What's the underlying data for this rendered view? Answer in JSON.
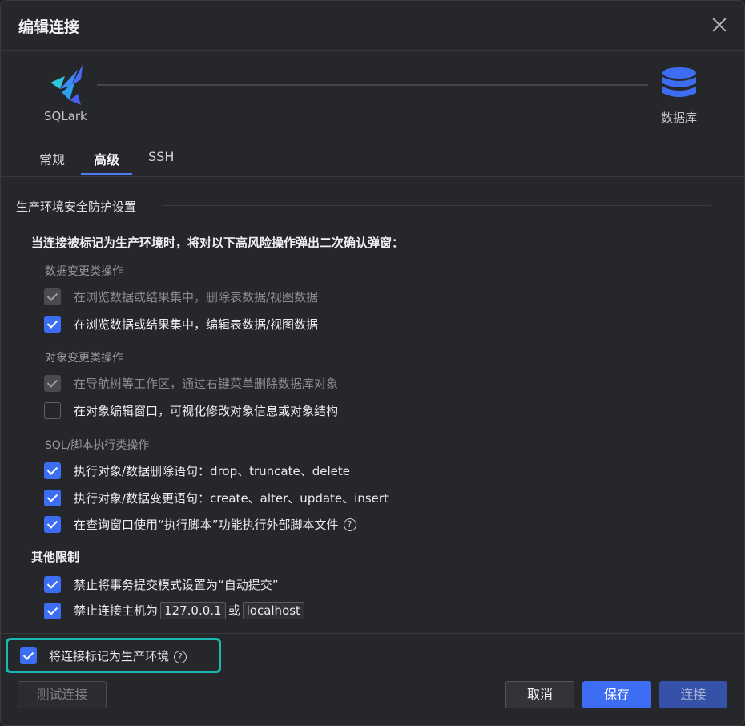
{
  "dialog": {
    "title": "编辑连接"
  },
  "header": {
    "source_label": "SQLark",
    "target_label": "数据库"
  },
  "tabs": [
    {
      "label": "常规",
      "active": false
    },
    {
      "label": "高级",
      "active": true
    },
    {
      "label": "SSH",
      "active": false
    }
  ],
  "section": {
    "title": "生产环境安全防护设置",
    "lead": "当连接被标记为生产环境时，将对以下高风险操作弹出二次确认弹窗：",
    "groups": [
      {
        "title": "数据变更类操作",
        "items": [
          {
            "label": "在浏览数据或结果集中，删除表数据/视图数据",
            "state": "checked-disabled"
          },
          {
            "label": "在浏览数据或结果集中，编辑表数据/视图数据",
            "state": "checked"
          }
        ]
      },
      {
        "title": "对象变更类操作",
        "items": [
          {
            "label": "在导航树等工作区，通过右键菜单删除数据库对象",
            "state": "checked-disabled"
          },
          {
            "label": "在对象编辑窗口，可视化修改对象信息或对象结构",
            "state": "unchecked"
          }
        ]
      },
      {
        "title": "SQL/脚本执行类操作",
        "items": [
          {
            "label": "执行对象/数据删除语句：drop、truncate、delete",
            "state": "checked"
          },
          {
            "label": "执行对象/数据变更语句：create、alter、update、insert",
            "state": "checked"
          },
          {
            "label": "在查询窗口使用“执行脚本”功能执行外部脚本文件",
            "state": "checked",
            "help": "?"
          }
        ]
      }
    ],
    "other": {
      "title": "其他限制",
      "items": [
        {
          "label": "禁止将事务提交模式设置为“自动提交”",
          "state": "checked"
        },
        {
          "label_prefix": "禁止连接主机为",
          "host1": "127.0.0.1",
          "or": "或",
          "host2": "localhost",
          "state": "checked"
        }
      ]
    }
  },
  "mark_production": {
    "label": "将连接标记为生产环境",
    "checked": true,
    "help": "?"
  },
  "footer": {
    "test_label": "测试连接",
    "cancel_label": "取消",
    "save_label": "保存",
    "connect_label": "连接"
  },
  "icons": {
    "close": "close-icon",
    "logo": "sqlark-logo-icon",
    "database": "database-icon",
    "help": "help-circle-icon"
  },
  "colors": {
    "accent": "#3d6df2",
    "highlight_border": "#19b8b0",
    "background": "#26272b"
  }
}
